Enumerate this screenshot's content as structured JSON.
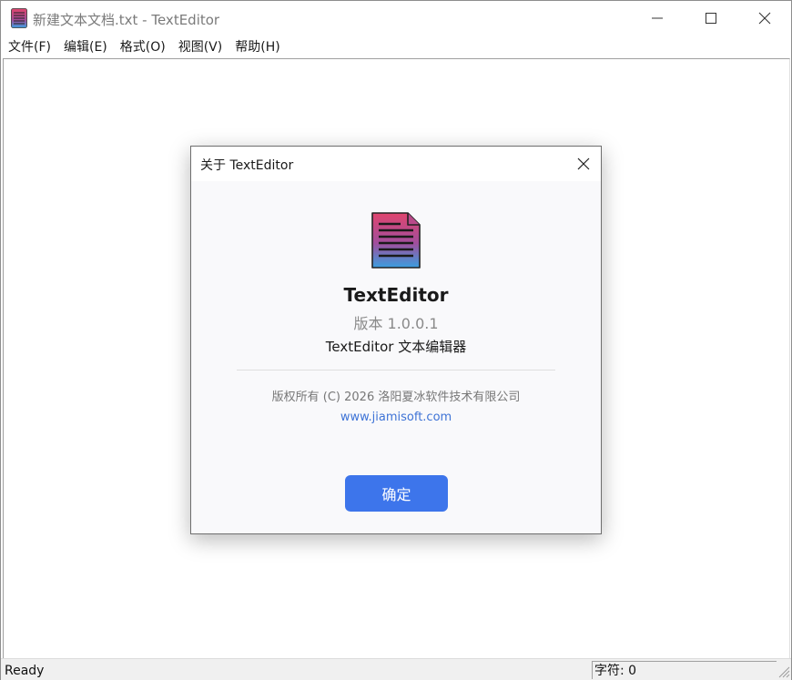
{
  "window": {
    "title": "新建文本文档.txt - TextEditor",
    "icon": "notepad-document-icon"
  },
  "menubar": {
    "items": [
      {
        "label": "文件(F)"
      },
      {
        "label": "编辑(E)"
      },
      {
        "label": "格式(O)"
      },
      {
        "label": "视图(V)"
      },
      {
        "label": "帮助(H)"
      }
    ]
  },
  "statusbar": {
    "ready": "Ready",
    "char_count": "字符: 0"
  },
  "dialog": {
    "title": "关于 TextEditor",
    "app_name": "TextEditor",
    "version": "版本 1.0.0.1",
    "description": "TextEditor 文本编辑器",
    "copyright": "版权所有 (C) 2026 洛阳夏冰软件技术有限公司",
    "website": "www.jiamisoft.com",
    "ok_label": "确定"
  },
  "colors": {
    "accent": "#3d75eb",
    "link": "#3e73d6",
    "logo_top": "#e0456e",
    "logo_bottom": "#3a9fe0"
  }
}
